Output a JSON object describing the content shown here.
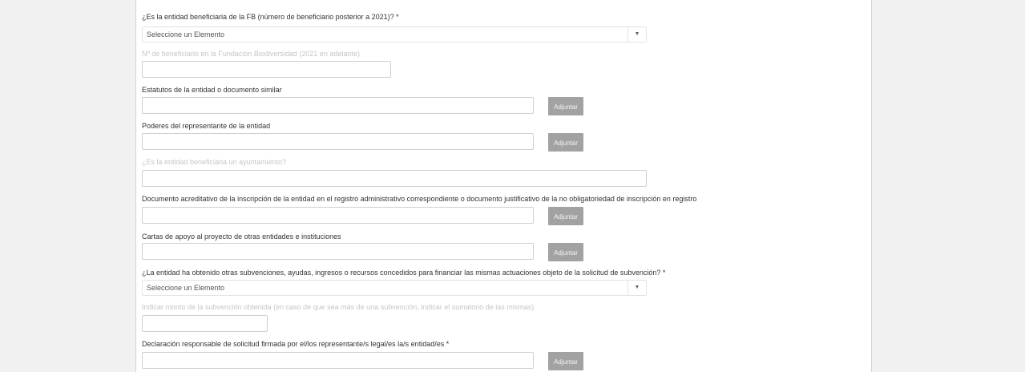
{
  "form": {
    "fb_beneficiary": {
      "label": "¿Es la entidad beneficiaria de la FB (número de beneficiario posterior a 2021)? *",
      "selected": "Seleccione un Elemento",
      "arrow": "▼"
    },
    "fb_number": {
      "label": "Nº de beneficiario en la Fundación Biodiversidad (2021 en adelante)",
      "value": ""
    },
    "statutes": {
      "label": "Estatutos de la entidad o documento similar",
      "button": "Adjuntar"
    },
    "powers": {
      "label": "Poderes del representante de la entidad",
      "button": "Adjuntar"
    },
    "is_city_council": {
      "label": "¿Es la entidad beneficiaria un ayuntamiento?",
      "value": ""
    },
    "registry_document": {
      "label": "Documento acreditativo de la inscripción de la entidad en el registro administrativo correspondiente o documento justificativo de la no obligatoriedad de inscripción en registro",
      "button": "Adjuntar"
    },
    "support_letters": {
      "label": "Cartas de apoyo al proyecto de otras entidades e instituciones",
      "button": "Adjuntar"
    },
    "other_grants": {
      "label": "¿La entidad ha obtenido otras subvenciones, ayudas, ingresos o recursos concedidos para financiar las mismas actuaciones objeto de la solicitud de subvención? *",
      "selected": "Seleccione un Elemento",
      "arrow": "▼"
    },
    "grant_amount": {
      "label": "Indicar monto de la subvención obtenida (en caso de que sea más de una subvención, indicar el sumatorio de las mismas)",
      "value": ""
    },
    "declaration": {
      "label": "Declaración responsable de solicitud firmada por el/los representante/s legal/es la/s entidad/es *",
      "button": "Adjuntar"
    }
  }
}
